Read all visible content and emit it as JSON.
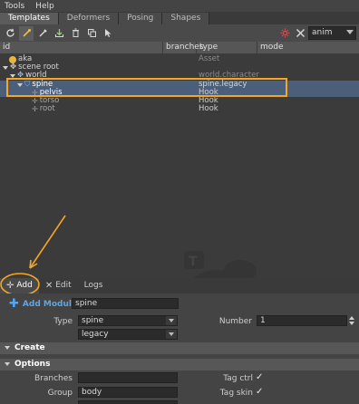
{
  "menu": [
    "Tools",
    "Help"
  ],
  "tabs": [
    {
      "label": "Templates",
      "active": true
    },
    {
      "label": "Deformers",
      "active": false
    },
    {
      "label": "Posing",
      "active": false
    },
    {
      "label": "Shapes",
      "active": false
    }
  ],
  "toolbar": {
    "anim_select": "anim",
    "icons": [
      "refresh-icon",
      "template-icon",
      "brush-icon",
      "import-icon",
      "delete-icon",
      "duplicate-icon",
      "select-icon",
      "settings-icon",
      "tools-icon"
    ]
  },
  "columns": {
    "id": "id",
    "branches": "branches",
    "type": "type",
    "mode": "mode"
  },
  "tree": [
    {
      "name": "aka",
      "type": "Asset"
    },
    {
      "name": "scene root",
      "type": ""
    },
    {
      "name": "world",
      "type": "world.character"
    },
    {
      "name": "spine",
      "type": "spine.legacy"
    },
    {
      "name": "pelvis",
      "type": "Hook"
    },
    {
      "name": "torso",
      "type": "Hook"
    },
    {
      "name": "root",
      "type": "Hook"
    }
  ],
  "bottom_tabs": [
    {
      "label": "Add",
      "active": true
    },
    {
      "label": "Edit",
      "active": false
    },
    {
      "label": "Logs",
      "active": false
    }
  ],
  "add_module": {
    "button_label": "Add Module",
    "name_value": "spine",
    "type_label": "Type",
    "type_value": "spine",
    "variant_value": "legacy",
    "number_label": "Number",
    "number_value": "1"
  },
  "sections": {
    "create": "Create",
    "options": "Options"
  },
  "options": {
    "branches_label": "Branches",
    "branches_value": "",
    "group_label": "Group",
    "group_value": "body",
    "tag_ctrl_label": "Tag ctrl",
    "tag_skin_label": "Tag skin",
    "tag_ctrl_checked": true,
    "tag_skin_checked": true
  },
  "colors": {
    "highlight": "#f5a623",
    "selection": "#4b5e7a"
  }
}
